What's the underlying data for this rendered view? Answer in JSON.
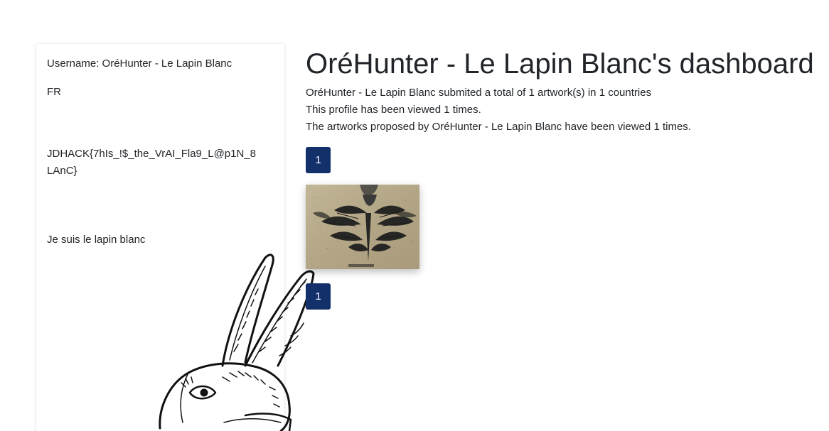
{
  "profile": {
    "username_line": "Username: OréHunter - Le Lapin Blanc",
    "country": "FR",
    "flag_text": "JDHACK{7hIs_!$_the_VrAI_Fla9_L@p1N_8LAnC}",
    "bio": "Je suis le lapin blanc"
  },
  "main": {
    "title": "OréHunter - Le Lapin Blanc's dashboard",
    "stats": [
      "OréHunter - Le Lapin Blanc submited a total of 1 artwork(s) in 1 countries",
      "This profile has been viewed 1 times.",
      "The artworks proposed by OréHunter - Le Lapin Blanc have been viewed 1 times."
    ],
    "pagination_top": "1",
    "pagination_bottom": "1"
  },
  "colors": {
    "pagination_bg": "#14306a",
    "artwork_bg": "#b8ab8d"
  }
}
